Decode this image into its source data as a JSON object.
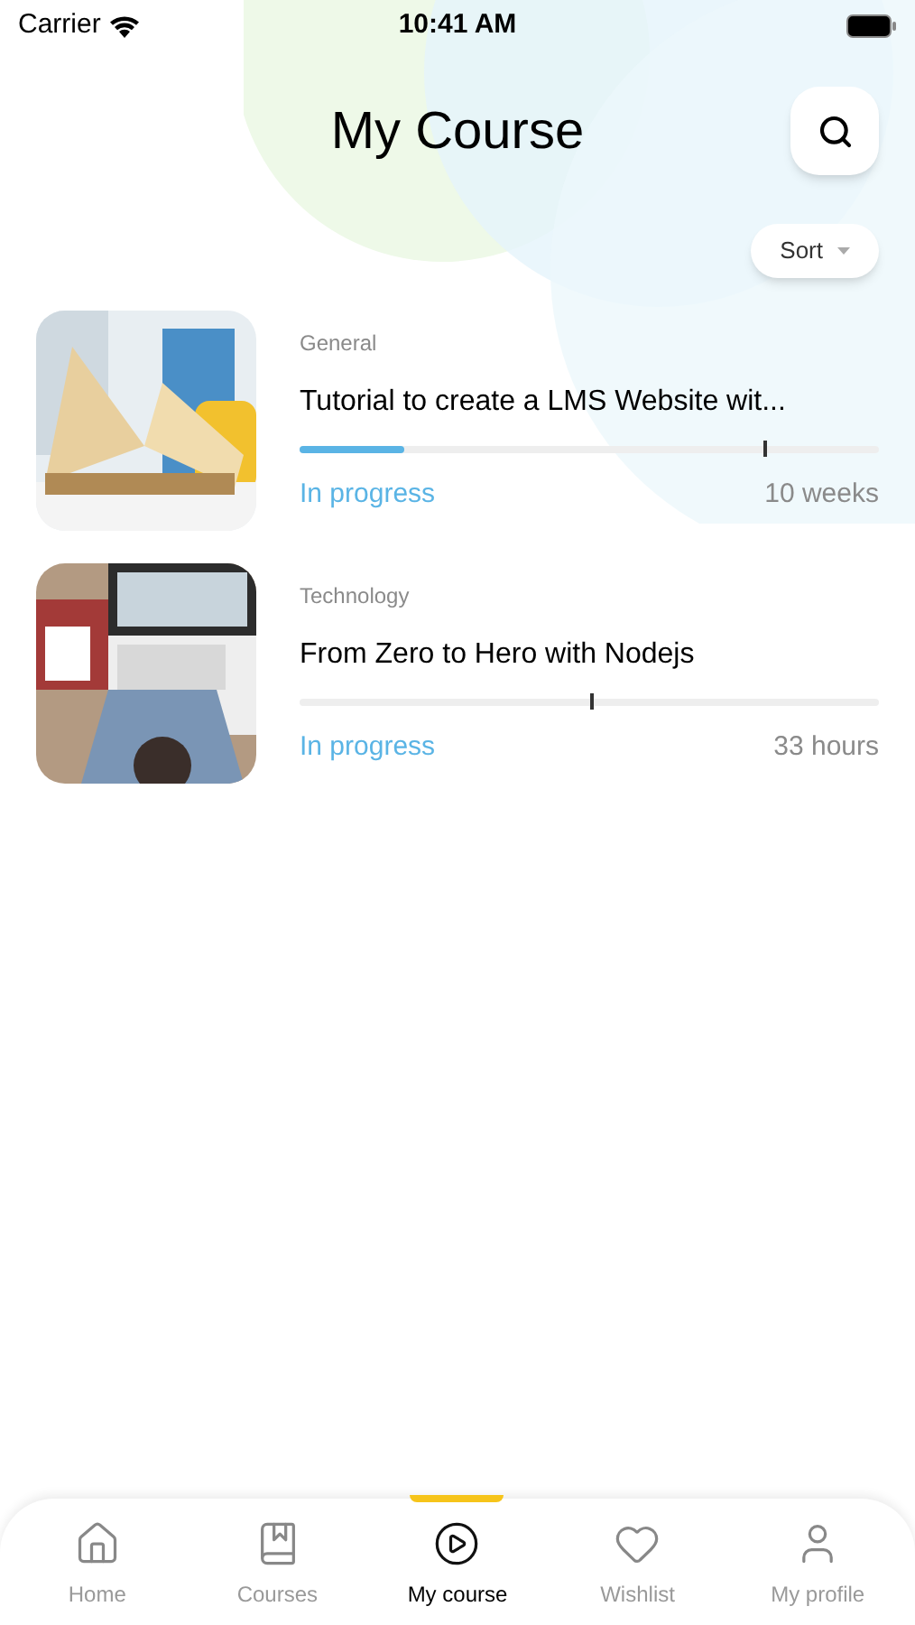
{
  "status_bar": {
    "carrier": "Carrier",
    "time": "10:41 AM"
  },
  "header": {
    "title": "My Course"
  },
  "sort": {
    "label": "Sort"
  },
  "courses": [
    {
      "kind": "picture",
      "category": "General",
      "title": "Tutorial to create a LMS Website wit...",
      "progress": {
        "level": 0.18
      },
      "marker": {
        "level": 0.8
      },
      "status": "In progress",
      "duration": "10 weeks"
    },
    {
      "kind": "picture",
      "category": "Technology",
      "title": "From Zero to Hero with Nodejs",
      "marker": {
        "level": 0.5
      },
      "status": "In progress",
      "duration": "33 hours"
    }
  ],
  "tab_bar": [
    {
      "label": "Home",
      "selected": false
    },
    {
      "label": "Courses",
      "selected": false
    },
    {
      "label": "My course",
      "selected": true
    },
    {
      "label": "Wishlist",
      "selected": false
    },
    {
      "label": "My profile",
      "selected": false
    }
  ]
}
